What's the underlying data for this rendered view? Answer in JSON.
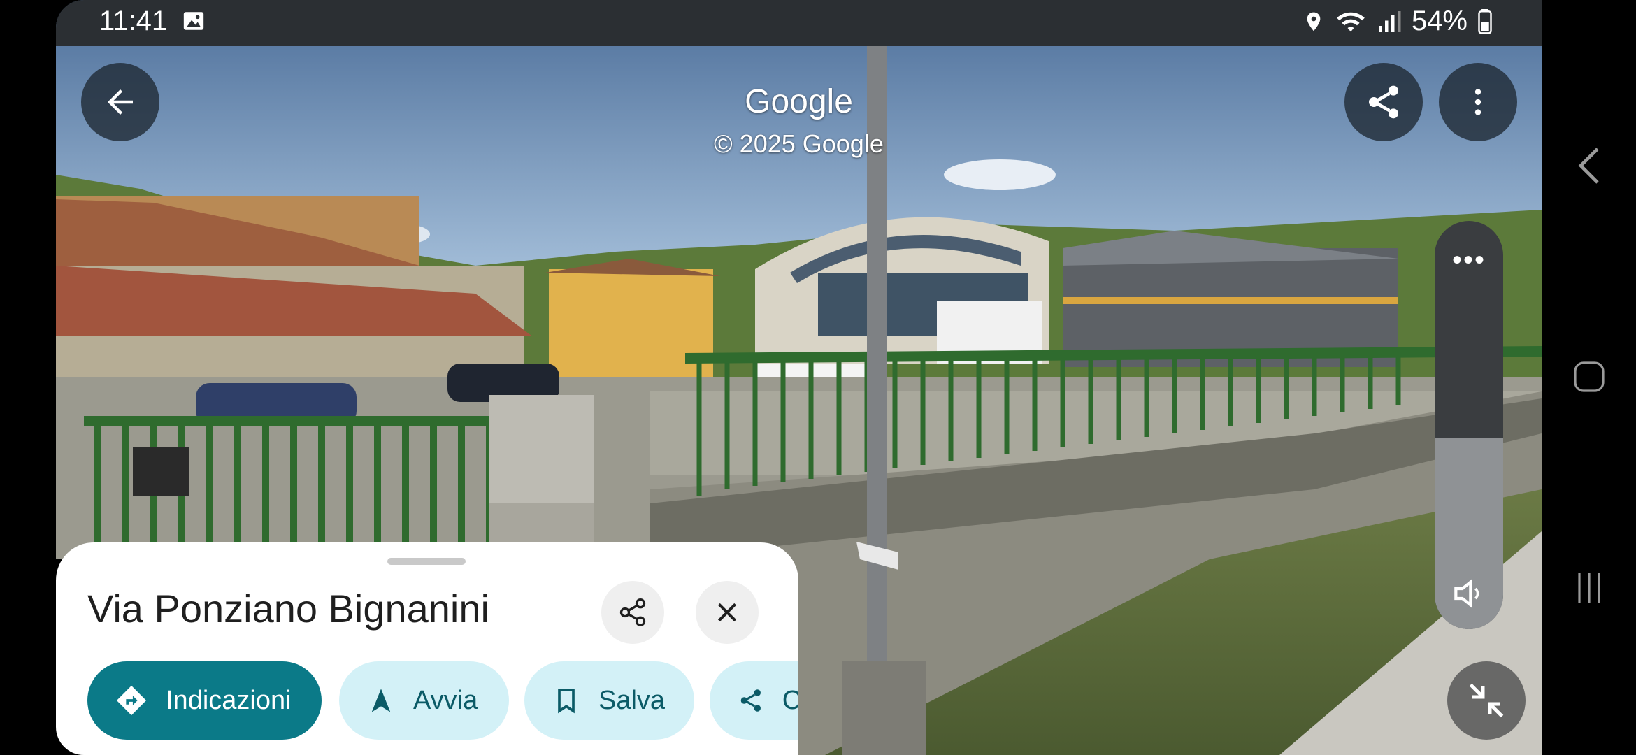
{
  "status_bar": {
    "time": "11:41",
    "battery": "54%"
  },
  "watermark": {
    "brand": "Google",
    "copyright": "© 2025 Google"
  },
  "place": {
    "title": "Via Ponziano Bignanini"
  },
  "actions": [
    {
      "label": "Indicazioni",
      "icon": "directions-icon"
    },
    {
      "label": "Avvia",
      "icon": "navigation-arrow-icon"
    },
    {
      "label": "Salva",
      "icon": "bookmark-icon"
    },
    {
      "label": "Condividi",
      "icon": "share-icon"
    }
  ],
  "volume": {
    "level": 0.47
  },
  "colors": {
    "primary": "#0b7a88",
    "chip_bg": "#d3f1f7",
    "chip_text": "#0b5b67"
  }
}
